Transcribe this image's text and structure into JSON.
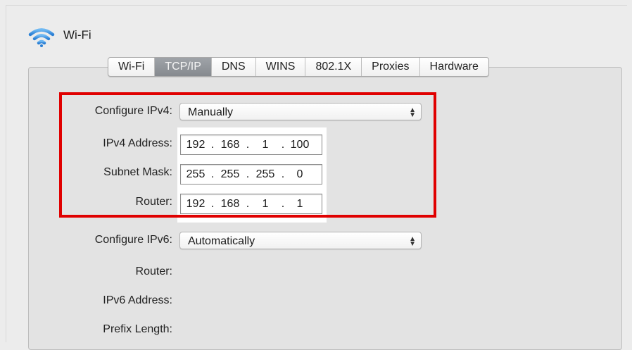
{
  "window": {
    "title": "Wi-Fi",
    "icon": "wifi-icon"
  },
  "tabs": [
    {
      "label": "Wi-Fi",
      "selected": false
    },
    {
      "label": "TCP/IP",
      "selected": true
    },
    {
      "label": "DNS",
      "selected": false
    },
    {
      "label": "WINS",
      "selected": false
    },
    {
      "label": "802.1X",
      "selected": false
    },
    {
      "label": "Proxies",
      "selected": false
    },
    {
      "label": "Hardware",
      "selected": false
    }
  ],
  "ipv4": {
    "configure_label": "Configure IPv4:",
    "configure_value": "Manually",
    "address_label": "IPv4 Address:",
    "address": [
      "192",
      "168",
      "1",
      "100"
    ],
    "subnet_label": "Subnet Mask:",
    "subnet": [
      "255",
      "255",
      "255",
      "0"
    ],
    "router_label": "Router:",
    "router": [
      "192",
      "168",
      "1",
      "1"
    ]
  },
  "ipv6": {
    "configure_label": "Configure IPv6:",
    "configure_value": "Automatically",
    "router_label": "Router:",
    "address_label": "IPv6 Address:",
    "prefix_label": "Prefix Length:"
  },
  "separators": {
    "dot": "."
  },
  "colors": {
    "highlight": "#e00000",
    "selected_tab": "#8c9095"
  }
}
